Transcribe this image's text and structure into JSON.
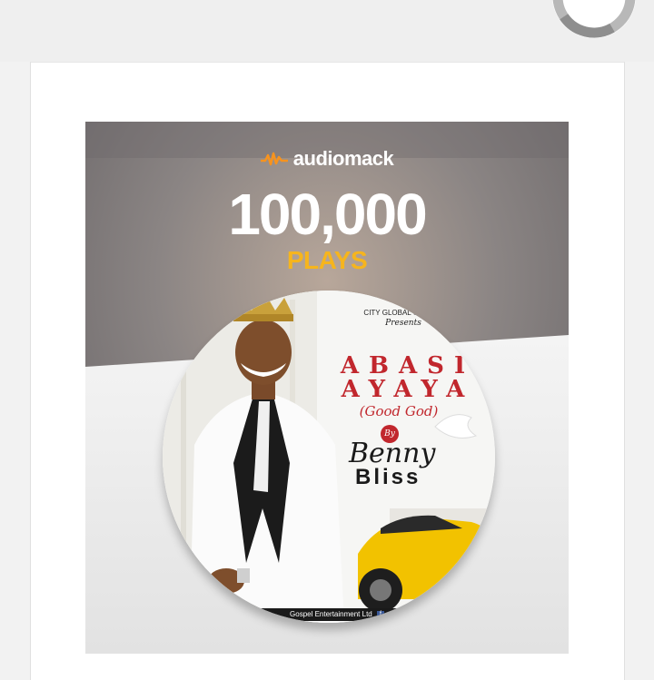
{
  "promo": {
    "brand_name": "audiomack",
    "plays_count": "100,000",
    "plays_label": "PLAYS"
  },
  "cover": {
    "presenter": "CITY GLOBAL GOSPEL",
    "presents": "Presents",
    "title_line1": "ABASI",
    "title_line2": "AYAYA",
    "subtitle": "(Good God)",
    "by_label": "By",
    "artist_first": "Benny",
    "artist_last": "Bliss",
    "footer_credit": "Gospel Entertainment Ltd"
  },
  "colors": {
    "brand_orange": "#f7931e",
    "plays_gold": "#f6b51d",
    "title_red": "#c1272d",
    "car_yellow": "#f2c200"
  },
  "icons": [
    "loading-spinner-icon",
    "audiomack-wave-icon",
    "facebook-icon"
  ]
}
